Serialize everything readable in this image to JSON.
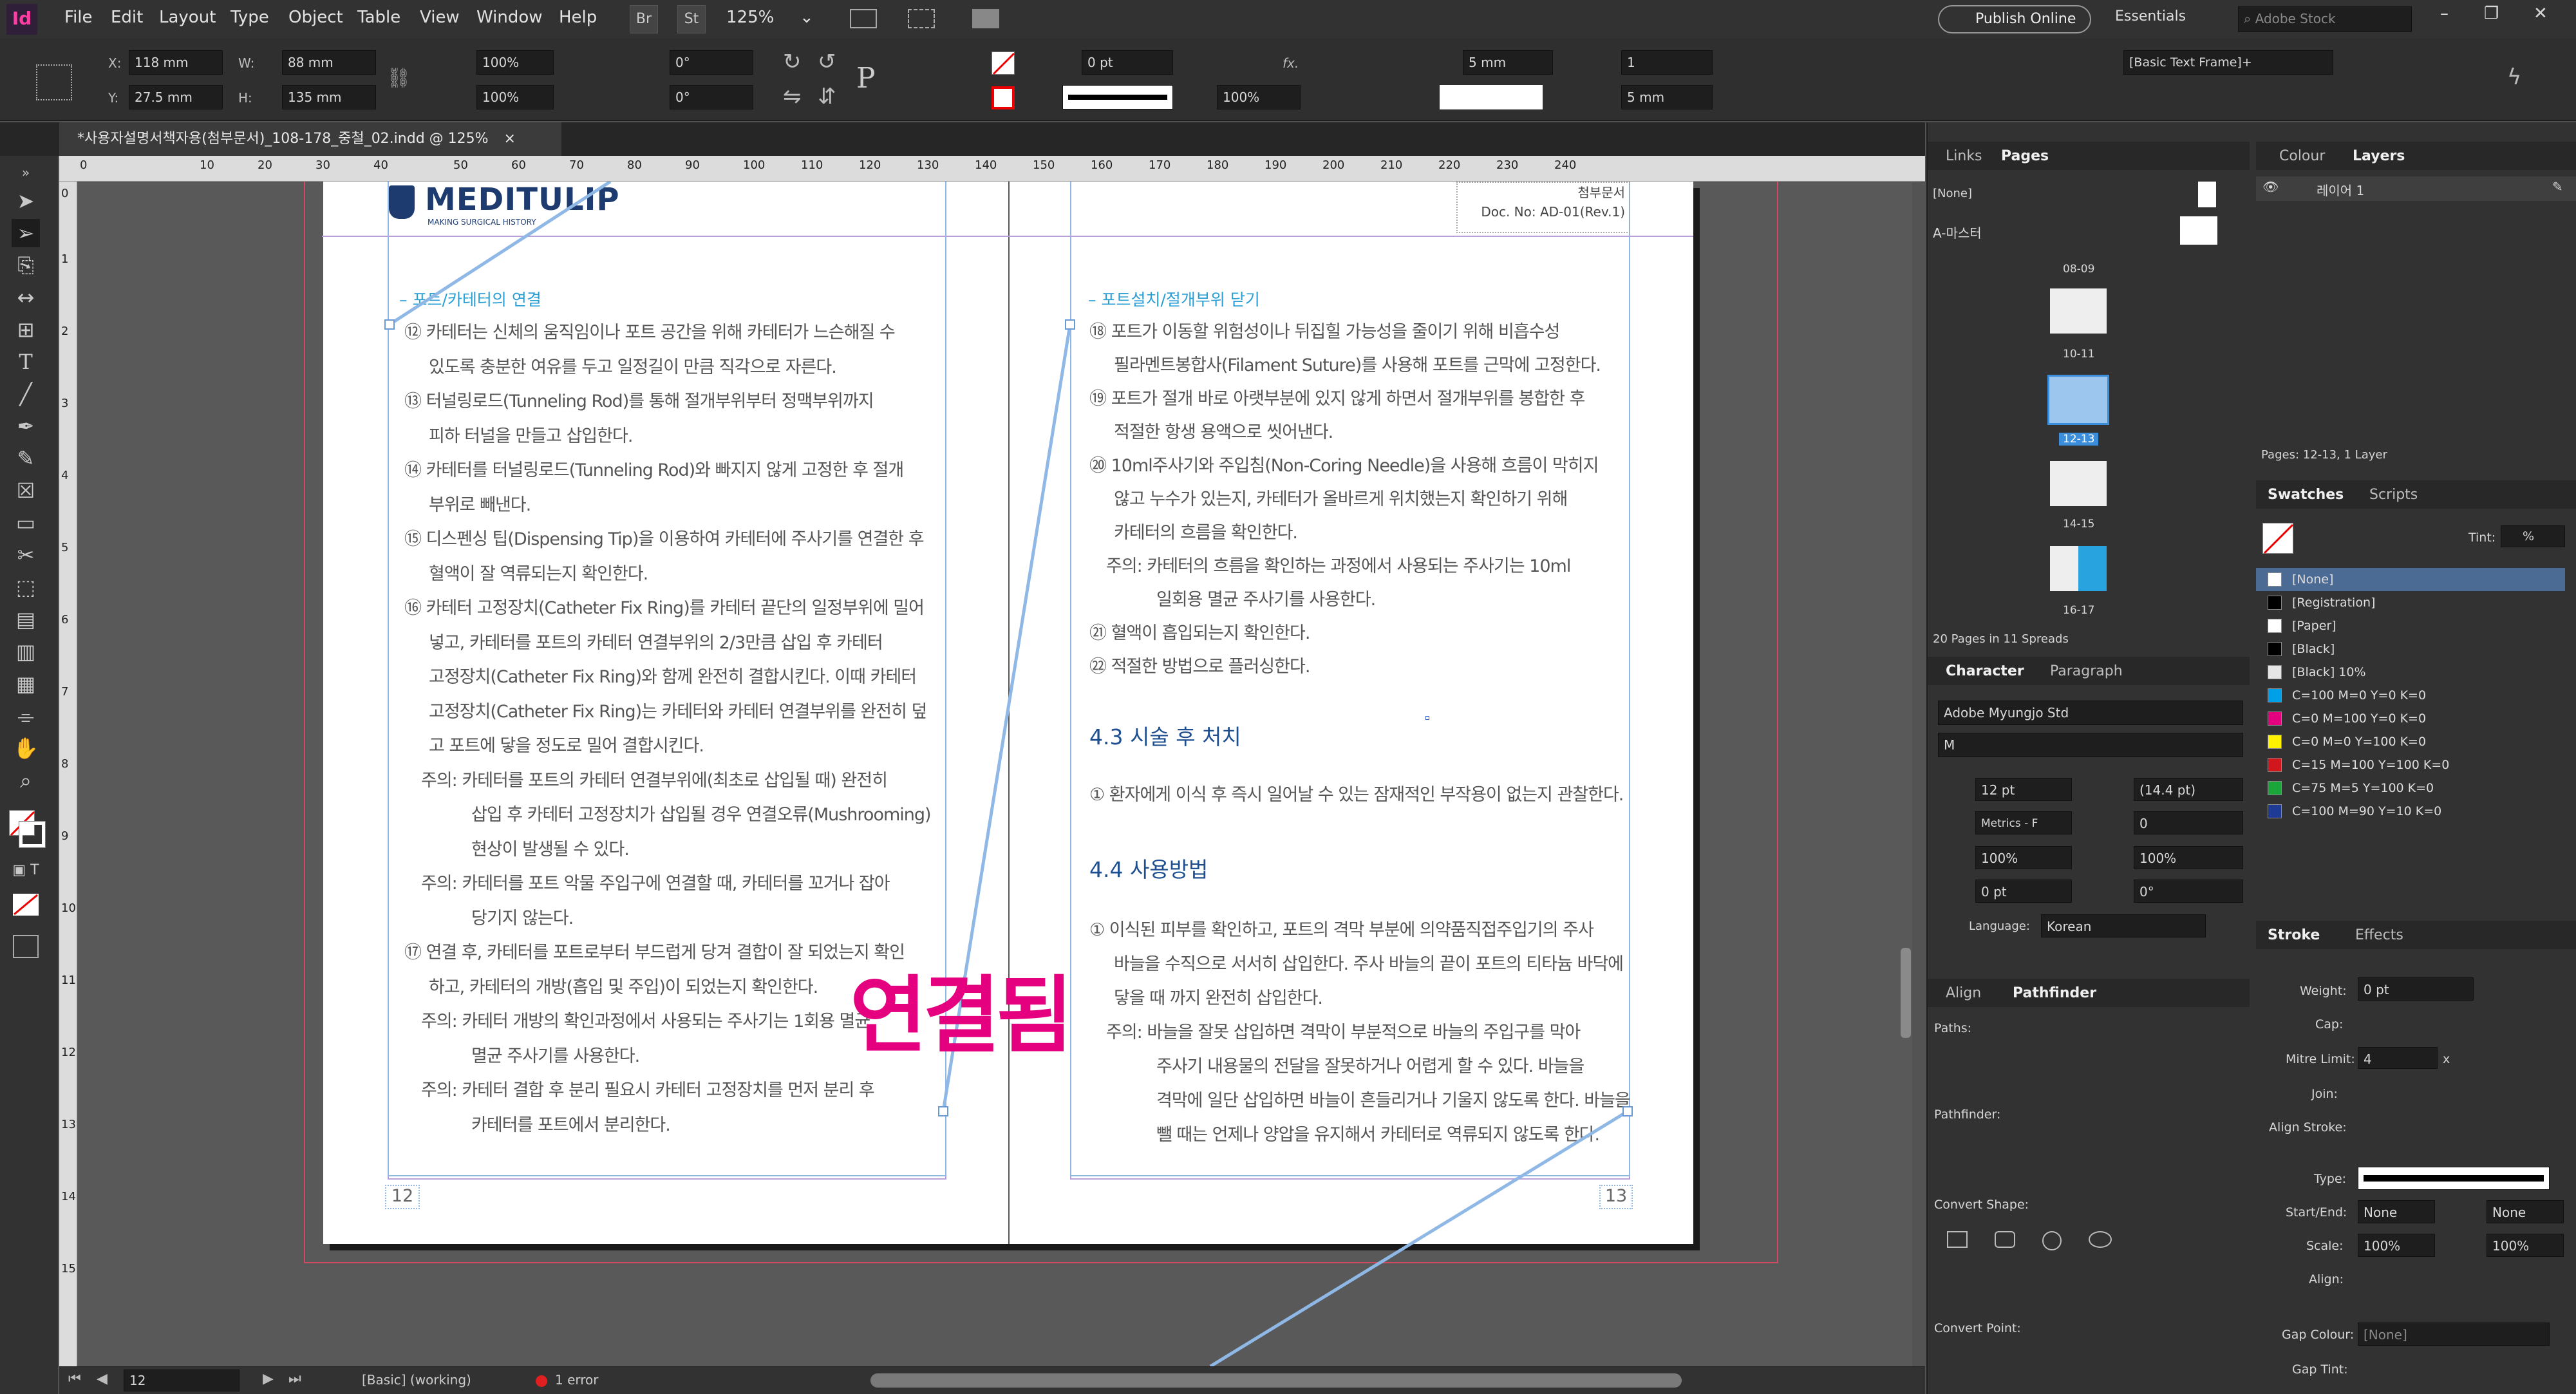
{
  "app": {
    "icon": "Id",
    "workspace": "Essentials",
    "publish": "Publish Online",
    "search_placeholder": "Adobe Stock"
  },
  "menu": [
    "File",
    "Edit",
    "Layout",
    "Type",
    "Object",
    "Table",
    "View",
    "Window",
    "Help"
  ],
  "menu_buttons": {
    "br": "Br",
    "st": "St",
    "zoom": "125%"
  },
  "control": {
    "x": "118 mm",
    "y": "27.5 mm",
    "w": "88 mm",
    "h": "135 mm",
    "scale_x": "100%",
    "scale_y": "100%",
    "rotate": "0°",
    "shear": "0°",
    "stroke_weight": "0 pt",
    "opacity": "100%",
    "gutter": "5 mm",
    "columns": "1",
    "col_gutter": "5 mm",
    "frame_style": "[Basic Text Frame]+",
    "labels": {
      "x": "X:",
      "y": "Y:",
      "w": "W:",
      "h": "H:",
      "fx": "fx."
    }
  },
  "document": {
    "tab_title": "*사용자설명서책자용(첨부문서)_108-178_중철_02.indd @ 125%",
    "close": "×"
  },
  "ruler": {
    "ticks": [
      "0",
      "10",
      "20",
      "30",
      "40",
      "50",
      "60",
      "70",
      "80",
      "90",
      "100",
      "110",
      "120",
      "130",
      "140",
      "150",
      "160",
      "170",
      "180",
      "190",
      "200",
      "210",
      "220",
      "230",
      "240"
    ],
    "v_ticks": [
      "0",
      "1",
      "2",
      "3",
      "4",
      "5",
      "6",
      "7",
      "8",
      "9",
      "10",
      "11",
      "12",
      "13",
      "14",
      "15"
    ]
  },
  "left_page": {
    "logo": "MEDITULIP",
    "logo_tagline": "MAKING SURGICAL HISTORY",
    "section": "– 포트/카테터의 연결",
    "lines": [
      "⑫ 카테터는 신체의 움직임이나 포트 공간을 위해 카테터가 느슨해질 수",
      "있도록 충분한 여유를 두고 일정길이 만큼 직각으로 자른다.",
      "⑬ 터널링로드(Tunneling Rod)를 통해 절개부위부터 정맥부위까지",
      "피하 터널을 만들고 삽입한다.",
      "⑭ 카테터를 터널링로드(Tunneling Rod)와 빠지지 않게 고정한 후 절개",
      "부위로 빼낸다.",
      "⑮ 디스펜싱 팁(Dispensing Tip)을 이용하여 카테터에 주사기를 연결한 후",
      "혈액이 잘 역류되는지 확인한다.",
      "⑯ 카테터 고정장치(Catheter Fix Ring)를 카테터 끝단의 일정부위에 밀어",
      "넣고, 카테터를 포트의 카테터 연결부위의 2/3만큼 삽입 후 카테터",
      "고정장치(Catheter Fix Ring)와 함께 완전히 결합시킨다. 이때 카테터",
      "고정장치(Catheter Fix Ring)는 카테터와 카테터 연결부위를 완전히 덮",
      "고 포트에 닿을 정도로 밀어 결합시킨다.",
      "주의: 카테터를 포트의 카테터 연결부위에(최초로 삽입될 때) 완전히",
      "삽입 후 카테터 고정장치가 삽입될 경우 연결오류(Mushrooming)",
      "현상이 발생될 수 있다.",
      "주의: 카테터를 포트 악물 주입구에 연결할 때, 카테터를 꼬거나 잡아",
      "당기지 않는다.",
      "⑰ 연결 후, 카테터를 포트로부터 부드럽게 당겨 결합이 잘 되었는지 확인",
      "하고, 카테터의 개방(흡입 및 주입)이 되었는지 확인한다.",
      "주의: 카테터 개방의 확인과정에서 사용되는 주사기는 1회용 멸균",
      "멸균 주사기를 사용한다.",
      "주의: 카테터 결합 후 분리 필요시 카테터 고정장치를 먼저 분리 후",
      "카테터를 포트에서 분리한다."
    ],
    "page_number": "12"
  },
  "right_page": {
    "header_lines": [
      "첨부문서",
      "Doc. No: AD-01(Rev.1)"
    ],
    "section": "– 포트설치/절개부위 닫기",
    "lines": [
      "⑱ 포트가 이동할 위험성이나 뒤집힐 가능성을 줄이기 위해 비흡수성",
      "필라멘트봉합사(Filament Suture)를 사용해 포트를 근막에 고정한다.",
      "⑲ 포트가 절개 바로 아랫부분에 있지 않게 하면서 절개부위를 봉합한 후",
      "적절한 항생 용액으로 씻어낸다.",
      "⑳ 10ml주사기와 주입침(Non-Coring Needle)을 사용해 흐름이 막히지",
      "않고 누수가 있는지, 카테터가 올바르게 위치했는지 확인하기 위해",
      "카테터의 흐름을 확인한다.",
      "주의: 카테터의 흐름을 확인하는 과정에서 사용되는 주사기는 10ml",
      "일회용 멸균 주사기를 사용한다.",
      "㉑ 혈액이 흡입되는지 확인한다.",
      "㉒ 적절한 방법으로 플러싱한다."
    ],
    "h43": "4.3 시술 후 처치",
    "p43": "① 환자에게 이식 후 즉시 일어날 수 있는 잠재적인 부작용이 없는지 관찰한다.",
    "h44": "4.4 사용방법",
    "lines44": [
      "① 이식된 피부를 확인하고, 포트의 격막 부분에 의약품직접주입기의 주사",
      "바늘을 수직으로 서서히 삽입한다. 주사 바늘의 끝이 포트의 티타늄 바닥에",
      "닿을 때 까지 완전히 삽입한다.",
      "주의: 바늘을 잘못 삽입하면 격막이 부분적으로 바늘의 주입구를 막아",
      "주사기 내용물의 전달을 잘못하거나 어렵게 할 수 있다. 바늘을",
      "격막에 일단 삽입하면 바늘이 흔들리거나 기울지 않도록 한다. 바늘을",
      "뺄 때는 언제나 양압을 유지해서 카테터로 역류되지 않도록 한다."
    ],
    "page_number": "13"
  },
  "overlay_text": "연결됨",
  "status": {
    "page": "12",
    "style": "[Basic] (working)",
    "errors": "1 error"
  },
  "panels": {
    "pages": {
      "tabs": [
        "Links",
        "Pages"
      ],
      "none": "[None]",
      "master": "A-마스터",
      "spreads": [
        "08-09",
        "10-11",
        "12-13",
        "14-15",
        "16-17"
      ],
      "footer": "20 Pages in 11 Spreads"
    },
    "layers": {
      "tabs": [
        "Colour",
        "Layers"
      ],
      "layer": "레이어 1",
      "footer": "Pages: 12-13, 1 Layer"
    },
    "swatches": {
      "tabs": [
        "Swatches",
        "Scripts"
      ],
      "tint_label": "Tint:",
      "tint_value": "%",
      "items": [
        {
          "name": "[None]",
          "color": "#ffffff"
        },
        {
          "name": "[Registration]",
          "color": "#000000"
        },
        {
          "name": "[Paper]",
          "color": "#ffffff"
        },
        {
          "name": "[Black]",
          "color": "#000000"
        },
        {
          "name": "[Black] 10%",
          "color": "#e6e6e6"
        },
        {
          "name": "C=100 M=0 Y=0 K=0",
          "color": "#00a0e9"
        },
        {
          "name": "C=0 M=100 Y=0 K=0",
          "color": "#e4007f"
        },
        {
          "name": "C=0 M=0 Y=100 K=0",
          "color": "#fff100"
        },
        {
          "name": "C=15 M=100 Y=100 K=0",
          "color": "#d2161e"
        },
        {
          "name": "C=75 M=5 Y=100 K=0",
          "color": "#1ba63b"
        },
        {
          "name": "C=100 M=90 Y=10 K=0",
          "color": "#1d3b95"
        }
      ]
    },
    "character": {
      "tabs": [
        "Character",
        "Paragraph"
      ],
      "font": "Adobe Myungjo Std",
      "style": "M",
      "size": "12 pt",
      "leading": "(14.4 pt)",
      "kerning": "Metrics - F",
      "tracking": "0",
      "vscale": "100%",
      "hscale": "100%",
      "baseline": "0 pt",
      "skew": "0°",
      "language_label": "Language:",
      "language": "Korean"
    },
    "stroke": {
      "tabs": [
        "Stroke",
        "Effects"
      ],
      "weight_label": "Weight:",
      "weight": "0 pt",
      "cap_label": "Cap:",
      "miter_label": "Mitre Limit:",
      "miter": "4",
      "miter_x": "x",
      "join_label": "Join:",
      "align_label": "Align Stroke:",
      "type_label": "Type:",
      "startend_label": "Start/End:",
      "start": "None",
      "end": "None",
      "scale_label": "Scale:",
      "scale1": "100%",
      "scale2": "100%",
      "align2_label": "Align:",
      "gapcolour_label": "Gap Colour:",
      "gapcolour": "[None]",
      "gaptint_label": "Gap Tint:"
    },
    "pathfinder": {
      "tabs": [
        "Align",
        "Pathfinder"
      ],
      "paths": "Paths:",
      "pathfinder": "Pathfinder:",
      "convert_shape": "Convert Shape:",
      "convert_point": "Convert Point:"
    }
  },
  "colors": {
    "accent_magenta": "#e4007f",
    "thread_blue": "#8fb8e6",
    "section_blue": "#2a9fd6",
    "heading_blue": "#1d4e8f"
  }
}
